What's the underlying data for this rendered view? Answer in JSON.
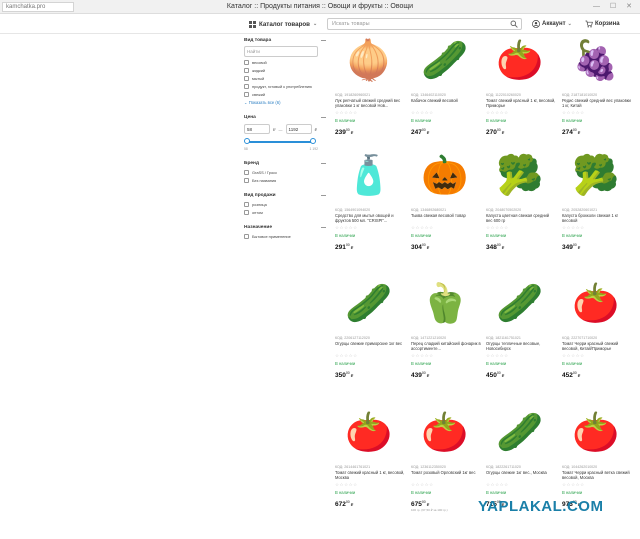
{
  "browser": {
    "site_tab": "kamchatka.pro",
    "title": "Каталог :: Продукты питания :: Овощи и фрукты :: Овощи",
    "controls": "— ☐ ✕"
  },
  "header": {
    "catalog_label": "Каталог товаров",
    "search_placeholder": "Искать товары",
    "account_label": "Аккаунт",
    "cart_label": "Корзина"
  },
  "filters": {
    "product_type": {
      "title": "Вид товара",
      "search_placeholder": "Найти",
      "options": [
        "весовой",
        "жидкий",
        "мытый",
        "продукт, готовый к употреблению",
        "свежий"
      ],
      "show_all": "Показать все (6)"
    },
    "price": {
      "title": "Цена",
      "min": "58",
      "max": "1192",
      "unit": "₽",
      "dash": "—",
      "range_min": "58",
      "range_max": "1 192",
      "slider_fraction": [
        0,
        1
      ]
    },
    "brand": {
      "title": "Бренд",
      "options": [
        "GraSS / Гросс",
        "Без названия"
      ]
    },
    "sale_type": {
      "title": "Вид продажи",
      "options": [
        "розница",
        "оптом"
      ]
    },
    "purpose": {
      "title": "Назначение",
      "options": [
        "Бытовое применение"
      ]
    }
  },
  "products": [
    {
      "code": "КОД: 1918260960021",
      "name": "Лук репчатый свежий средний вес упаковки 1 кг весовой Нов...",
      "stock": "В наличии",
      "price_int": "239",
      "price_dec": "00",
      "currency": "₽",
      "emoji": "🧅"
    },
    {
      "code": "КОД: 1346402110020",
      "name": "Кабачок свежий весовой",
      "stock": "В наличии",
      "price_int": "247",
      "price_dec": "00",
      "currency": "₽",
      "emoji": "🥒"
    },
    {
      "code": "КОД: 1122010260020",
      "name": "Томат свежий красный 1 кг, весовой, Приморье",
      "stock": "В наличии",
      "price_int": "270",
      "price_dec": "00",
      "currency": "₽",
      "emoji": "🍅"
    },
    {
      "code": "КОД: 2187181010020",
      "name": "Редис свежий средний вес упаковки 1 кг, Китай",
      "stock": "В наличии",
      "price_int": "274",
      "price_dec": "00",
      "currency": "₽",
      "emoji": "🍇"
    },
    {
      "code": "КОД: 1564901094020",
      "name": "Средство для мытья овощей и фруктов 500 мл. \"CRISPI\"...",
      "stock": "В наличии",
      "price_int": "291",
      "price_dec": "00",
      "currency": "₽",
      "emoji": "🧴"
    },
    {
      "code": "КОД: 1346892680021",
      "name": "Тыква свежая весовой товар",
      "stock": "В наличии",
      "price_int": "304",
      "price_dec": "00",
      "currency": "₽",
      "emoji": "🎃"
    },
    {
      "code": "КОД: 2048070502020",
      "name": "Капуста цветная свежая средний вес 600 гр",
      "stock": "В наличии",
      "price_int": "348",
      "price_dec": "00",
      "currency": "₽",
      "emoji": "🥦"
    },
    {
      "code": "КОД: 2052820601021",
      "name": "Капуста брокколи свежая 1 кг весовой",
      "stock": "В наличии",
      "price_int": "349",
      "price_dec": "00",
      "currency": "₽",
      "emoji": "🥦"
    },
    {
      "code": "КОД: 2206127112020",
      "name": "Огурцы свежие приморские 1кг вес",
      "stock": "В наличии",
      "price_int": "350",
      "price_dec": "00",
      "currency": "₽",
      "emoji": "🥒"
    },
    {
      "code": "КОД: 1471221210020",
      "name": "Перец сладкий китайский фонарик в ассортименте...",
      "stock": "В наличии",
      "price_int": "439",
      "price_dec": "00",
      "currency": "₽",
      "emoji": "🫑"
    },
    {
      "code": "КОД: 1821161751021",
      "name": "Огурцы тепличные весовые, Новосибирск",
      "stock": "В наличии",
      "price_int": "450",
      "price_dec": "00",
      "currency": "₽",
      "emoji": "🥒"
    },
    {
      "code": "КОД: 2227071710020",
      "name": "Томат Черри красный свежий весовой, Китай/Приморье",
      "stock": "В наличии",
      "price_int": "452",
      "price_dec": "00",
      "currency": "₽",
      "emoji": "🍅"
    },
    {
      "code": "КОД: 2614461761021",
      "name": "Томат свежий красный 1 кг, весовой, Москва",
      "stock": "В наличии",
      "price_int": "672",
      "price_dec": "00",
      "currency": "₽",
      "emoji": "🍅"
    },
    {
      "code": "КОД: 1236112350020",
      "name": "Томат розовый Орловский 1кг вес",
      "stock": "В наличии",
      "price_int": "675",
      "price_dec": "00",
      "currency": "₽",
      "note": "100 гр. (67,50 ₽ за 100 гр.)",
      "emoji": "🍅"
    },
    {
      "code": "КОД: 1822261711020",
      "name": "Огурцы свежие 1кг вес., Москва",
      "stock": "В наличии",
      "price_int": "715",
      "price_dec": "00",
      "currency": "₽",
      "emoji": "🥒"
    },
    {
      "code": "КОД: 1044262010020",
      "name": "Томат Черри красный ветка свежий весовой, Москва",
      "stock": "В наличии",
      "price_int": "973",
      "price_dec": "00",
      "currency": "₽",
      "emoji": "🍅"
    }
  ],
  "stars": "☆☆☆☆☆",
  "watermark": "YAPLAKAL.COM",
  "colors": {
    "accent": "#2a8fd8",
    "in_stock": "#2ea44f",
    "watermark": "#1a7fa8"
  }
}
